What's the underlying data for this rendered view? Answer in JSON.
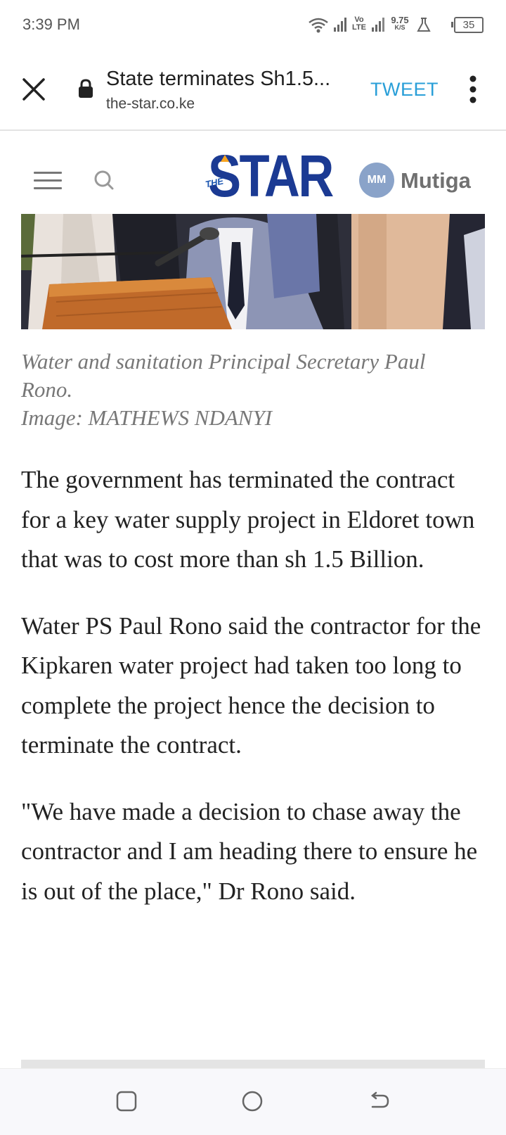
{
  "status_bar": {
    "time": "3:39 PM",
    "network_speed_value": "9.75",
    "network_speed_unit": "K/S",
    "volte_top": "Vo",
    "volte_bottom": "LTE",
    "battery_level": "35"
  },
  "browser_toolbar": {
    "page_title": "State terminates Sh1.5...",
    "url": "the-star.co.ke",
    "tweet_label": "TWEET"
  },
  "site_header": {
    "logo_small": "THE",
    "logo_main": "STAR",
    "avatar_initials": "MM",
    "username": "Mutiga",
    "colors": {
      "logo_blue": "#1b3a93",
      "logo_accent": "#f7a521",
      "avatar_bg": "#8aa3c9",
      "tweet_blue": "#2a9fd8"
    }
  },
  "photo": {
    "caption": "Water and sanitation Principal Secretary Paul Rono.",
    "credit": "Image: MATHEWS NDANYI"
  },
  "article": {
    "paragraphs": [
      "The government has terminated the contract for a key water supply project in Eldoret town that was to cost more than sh 1.5 Billion.",
      "Water PS Paul Rono said the contractor for the Kipkaren water project had taken too long to complete the project hence the decision to terminate the contract.",
      "\"We have made a decision to chase away the contractor and I am heading there to ensure he is out of the place,\" Dr Rono said."
    ]
  },
  "nav_bar": {
    "icons": [
      "recent-apps-icon",
      "home-icon",
      "back-icon"
    ]
  }
}
